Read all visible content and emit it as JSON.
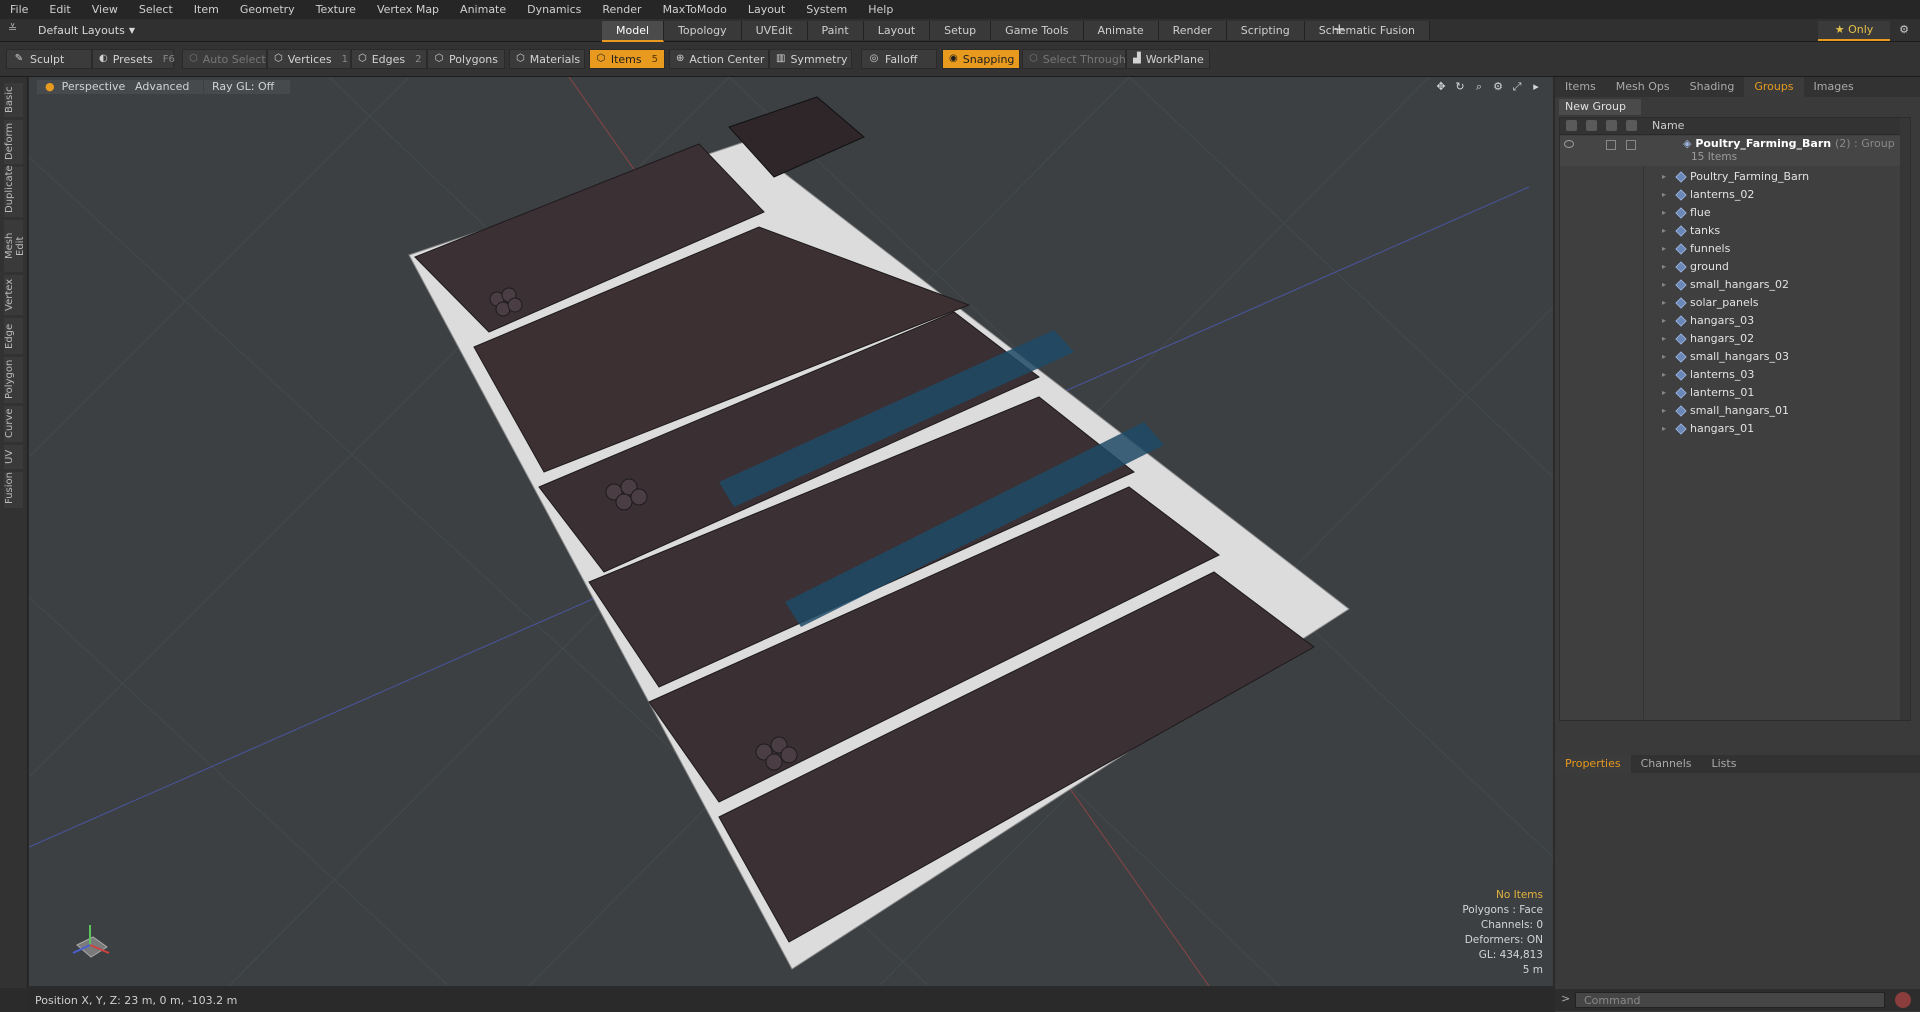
{
  "menu": [
    "File",
    "Edit",
    "View",
    "Select",
    "Item",
    "Geometry",
    "Texture",
    "Vertex Map",
    "Animate",
    "Dynamics",
    "Render",
    "MaxToModo",
    "Layout",
    "System",
    "Help"
  ],
  "layout_selector": "Default Layouts",
  "mode_tabs": [
    {
      "label": "Model",
      "active": true
    },
    {
      "label": "Topology"
    },
    {
      "label": "UVEdit"
    },
    {
      "label": "Paint"
    },
    {
      "label": "Layout"
    },
    {
      "label": "Setup"
    },
    {
      "label": "Game Tools"
    },
    {
      "label": "Animate"
    },
    {
      "label": "Render"
    },
    {
      "label": "Scripting"
    },
    {
      "label": "Schematic Fusion"
    }
  ],
  "only_button": "Only",
  "toolbar": {
    "sculpt": "Sculpt",
    "presets": "Presets",
    "presets_key": "F6",
    "auto_select": "Auto Select",
    "vertices": "Vertices",
    "vertices_key": "1",
    "edges": "Edges",
    "edges_key": "2",
    "polygons": "Polygons",
    "materials": "Materials",
    "items": "Items",
    "items_key": "5",
    "action_center": "Action Center",
    "symmetry": "Symmetry",
    "falloff": "Falloff",
    "snapping": "Snapping",
    "select_through": "Select Through",
    "workplane": "WorkPlane"
  },
  "left_tabs": [
    "Basic",
    "Deform",
    "Duplicate",
    "Mesh Edit",
    "Vertex",
    "Edge",
    "Polygon",
    "Curve",
    "UV",
    "Fusion"
  ],
  "viewport": {
    "view": "Perspective",
    "shading": "Advanced",
    "raygl": "Ray GL: Off",
    "info": {
      "no_items": "No Items",
      "polygons": "Polygons : Face",
      "channels": "Channels: 0",
      "deformers": "Deformers: ON",
      "gl": "GL: 434,813",
      "scale": "5 m"
    }
  },
  "status": "Position X, Y, Z:  23 m, 0 m, -103.2 m",
  "right_panel": {
    "tabs": [
      {
        "label": "Items"
      },
      {
        "label": "Mesh Ops"
      },
      {
        "label": "Shading"
      },
      {
        "label": "Groups",
        "active": true
      },
      {
        "label": "Images"
      }
    ],
    "new_group": "New Group",
    "column_name": "Name",
    "group": {
      "name": "Poultry_Farming_Barn",
      "suffix": "(2) : Group",
      "count": "15 Items"
    },
    "items": [
      "Poultry_Farming_Barn",
      "lanterns_02",
      "flue",
      "tanks",
      "funnels",
      "ground",
      "small_hangars_02",
      "solar_panels",
      "hangars_03",
      "hangars_02",
      "small_hangars_03",
      "lanterns_03",
      "lanterns_01",
      "small_hangars_01",
      "hangars_01"
    ],
    "bottom_tabs": [
      {
        "label": "Properties",
        "active": true
      },
      {
        "label": "Channels"
      },
      {
        "label": "Lists"
      }
    ],
    "command_placeholder": "Command"
  },
  "colors": {
    "accent": "#e79a1e",
    "viewport_bg": "#3c4043",
    "roof": "#3a2e30",
    "concrete": "#d9d9d9",
    "solar": "#1f4a66"
  }
}
